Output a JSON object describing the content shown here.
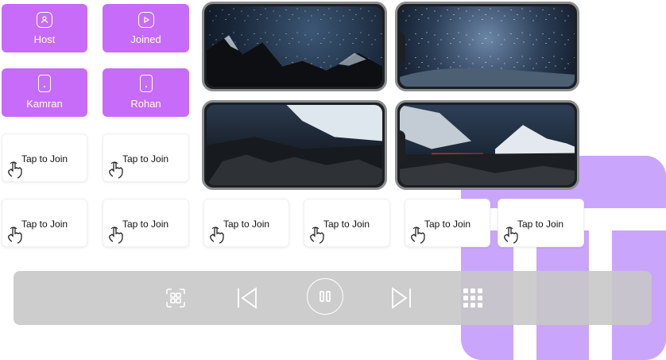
{
  "tiles": {
    "host": {
      "name": "Host",
      "icon": "user-badge-icon"
    },
    "joined": {
      "name": "Joined",
      "icon": "play-badge-icon"
    },
    "kamran": {
      "name": "Kamran",
      "icon": "phone-icon"
    },
    "rohan": {
      "name": "Rohan",
      "icon": "phone-icon"
    },
    "join_label": "Tap to Join"
  },
  "controls": {
    "icons": [
      "scan-icon",
      "previous-icon",
      "pause-icon",
      "next-icon",
      "grid-icon"
    ]
  },
  "colors": {
    "accent": "#c66cf8",
    "decor": "#c9a6fb",
    "bar": "#c8c8c8"
  }
}
